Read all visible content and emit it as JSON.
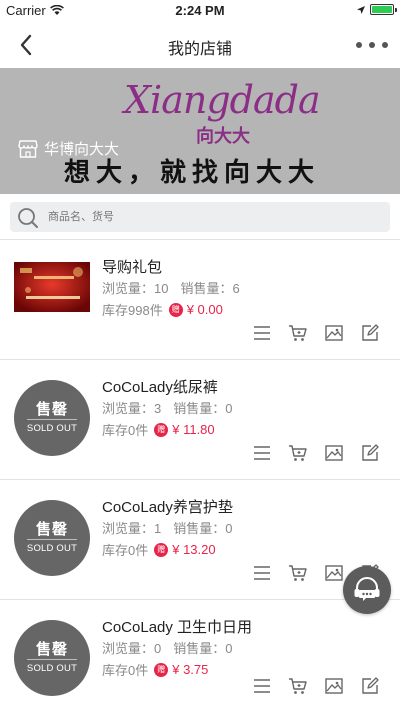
{
  "status_bar": {
    "carrier": "Carrier",
    "time": "2:24 PM",
    "battery_color": "#2dcc53"
  },
  "nav": {
    "title": "我的店铺"
  },
  "banner": {
    "brand_script": "Xiangdada",
    "brand_cn": "向大大",
    "slogan": "想大，就找向大大",
    "shop_name": "华博向大大"
  },
  "search": {
    "placeholder": "商品名、货号"
  },
  "products": [
    {
      "name": "导购礼包",
      "views_label": "浏览量：10",
      "sales_label": "销售量：6",
      "stock": "库存998件",
      "badge": "赠",
      "price": "¥ 0.00",
      "sold_out": false
    },
    {
      "name": "CoCoLady纸尿裤",
      "views_label": "浏览量：3",
      "sales_label": "销售量：0",
      "stock": "库存0件",
      "badge": "赠",
      "price": "¥ 11.80",
      "sold_out": true
    },
    {
      "name": "CoCoLady养宫护垫",
      "views_label": "浏览量：1",
      "sales_label": "销售量：0",
      "stock": "库存0件",
      "badge": "赠",
      "price": "¥ 13.20",
      "sold_out": true
    },
    {
      "name": "CoCoLady 卫生巾日用",
      "views_label": "浏览量：0",
      "sales_label": "销售量：0",
      "stock": "库存0件",
      "badge": "赠",
      "price": "¥ 3.75",
      "sold_out": true
    }
  ],
  "sold_out_badge": {
    "cn": "售罄",
    "en": "SOLD OUT"
  },
  "accent_color": "#e8244a"
}
